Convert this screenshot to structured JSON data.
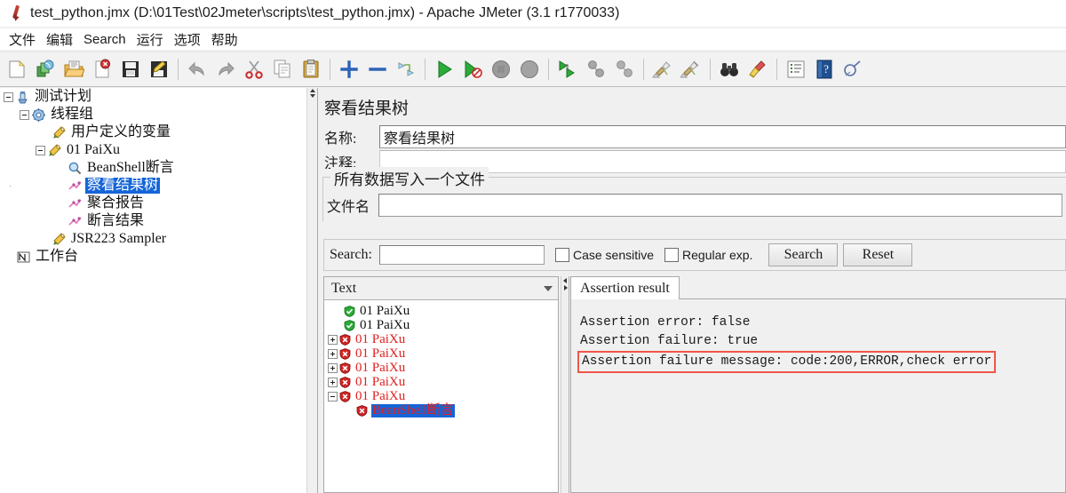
{
  "window": {
    "icon": "jmeter-feather-icon",
    "title": "test_python.jmx (D:\\01Test\\02Jmeter\\scripts\\test_python.jmx) - Apache JMeter (3.1 r1770033)"
  },
  "menubar": {
    "items": [
      {
        "label": "文件",
        "name": "menu-file"
      },
      {
        "label": "编辑",
        "name": "menu-edit"
      },
      {
        "label": "Search",
        "name": "menu-search"
      },
      {
        "label": "运行",
        "name": "menu-run"
      },
      {
        "label": "选项",
        "name": "menu-options"
      },
      {
        "label": "帮助",
        "name": "menu-help"
      }
    ]
  },
  "toolbar": {
    "buttons": [
      {
        "name": "new-icon",
        "tip": "New"
      },
      {
        "name": "templates-icon",
        "tip": "Templates"
      },
      {
        "name": "open-icon",
        "tip": "Open"
      },
      {
        "name": "close-icon",
        "tip": "Close"
      },
      {
        "name": "save-icon",
        "tip": "Save"
      },
      {
        "name": "save-as-icon",
        "tip": "Save As"
      },
      {
        "name": "undo-icon",
        "tip": "Undo"
      },
      {
        "name": "redo-icon",
        "tip": "Redo"
      },
      {
        "name": "cut-icon",
        "tip": "Cut"
      },
      {
        "name": "copy-icon",
        "tip": "Copy"
      },
      {
        "name": "paste-icon",
        "tip": "Paste"
      },
      {
        "name": "expand-all-icon",
        "tip": "Expand All"
      },
      {
        "name": "collapse-all-icon",
        "tip": "Collapse All"
      },
      {
        "name": "toggle-icon",
        "tip": "Toggle"
      },
      {
        "name": "start-icon",
        "tip": "Start"
      },
      {
        "name": "start-no-pauses-icon",
        "tip": "Start no pauses"
      },
      {
        "name": "stop-icon",
        "tip": "Stop"
      },
      {
        "name": "shutdown-icon",
        "tip": "Shutdown"
      },
      {
        "name": "remote-start-all-icon",
        "tip": "Remote Start All"
      },
      {
        "name": "remote-stop-all-icon",
        "tip": "Remote Stop All"
      },
      {
        "name": "remote-shutdown-all-icon",
        "tip": "Remote Shutdown All"
      },
      {
        "name": "clear-icon",
        "tip": "Clear"
      },
      {
        "name": "clear-all-icon",
        "tip": "Clear All"
      },
      {
        "name": "search-icon",
        "tip": "Search"
      },
      {
        "name": "search-reset-icon",
        "tip": "Reset Search"
      },
      {
        "name": "function-helper-icon",
        "tip": "Function Helper Dialog"
      },
      {
        "name": "help-icon",
        "tip": "Help"
      },
      {
        "name": "log-viewer-icon",
        "tip": "Log Viewer"
      }
    ]
  },
  "tree": {
    "nodes": [
      {
        "label": "测试计划",
        "depth": 0,
        "toggle": "minus",
        "icon": "test-plan-icon",
        "selected": false
      },
      {
        "label": "线程组",
        "depth": 1,
        "toggle": "minus",
        "icon": "thread-group-icon",
        "selected": false
      },
      {
        "label": "用户定义的变量",
        "depth": 2,
        "toggle": "none",
        "icon": "config-icon",
        "selected": false
      },
      {
        "label": "01 PaiXu",
        "depth": 2,
        "toggle": "minus",
        "icon": "sampler-icon",
        "selected": false
      },
      {
        "label": "BeanShell断言",
        "depth": 3,
        "toggle": "none",
        "icon": "assertion-icon",
        "selected": false
      },
      {
        "label": "察看结果树",
        "depth": 3,
        "toggle": "none",
        "icon": "listener-icon",
        "selected": true
      },
      {
        "label": "聚合报告",
        "depth": 3,
        "toggle": "none",
        "icon": "listener-icon",
        "selected": false
      },
      {
        "label": "断言结果",
        "depth": 3,
        "toggle": "none",
        "icon": "listener-icon",
        "selected": false
      },
      {
        "label": "JSR223 Sampler",
        "depth": 2,
        "toggle": "none",
        "icon": "sampler-icon",
        "selected": false
      },
      {
        "label": "工作台",
        "depth": 0,
        "toggle": "none",
        "icon": "workbench-icon",
        "selected": false
      }
    ]
  },
  "editor": {
    "panel_title": "察看结果树",
    "name_label": "名称:",
    "name_value": "察看结果树",
    "comment_label": "注释:",
    "comment_value": "",
    "group_title": "所有数据写入一个文件",
    "filename_label": "文件名",
    "filename_value": ""
  },
  "search": {
    "label": "Search:",
    "value": "",
    "case_sensitive_label": "Case sensitive",
    "case_sensitive_checked": false,
    "regex_label": "Regular exp.",
    "regex_checked": false,
    "search_button": "Search",
    "reset_button": "Reset"
  },
  "results": {
    "renderer_selected": "Text",
    "renderer_options": [
      "Text"
    ],
    "items": [
      {
        "label": "01 PaiXu",
        "depth": 1,
        "status": "ok",
        "toggle": "none",
        "selected": false
      },
      {
        "label": "01 PaiXu",
        "depth": 1,
        "status": "ok",
        "toggle": "none",
        "selected": false
      },
      {
        "label": "01 PaiXu",
        "depth": 1,
        "status": "error",
        "toggle": "plus",
        "selected": false
      },
      {
        "label": "01 PaiXu",
        "depth": 1,
        "status": "error",
        "toggle": "plus",
        "selected": false
      },
      {
        "label": "01 PaiXu",
        "depth": 1,
        "status": "error",
        "toggle": "plus",
        "selected": false
      },
      {
        "label": "01 PaiXu",
        "depth": 1,
        "status": "error",
        "toggle": "plus",
        "selected": false
      },
      {
        "label": "01 PaiXu",
        "depth": 1,
        "status": "error",
        "toggle": "minus",
        "selected": false
      },
      {
        "label": "BeanShell断言",
        "depth": 2,
        "status": "error",
        "toggle": "none",
        "selected": true
      }
    ]
  },
  "assertion": {
    "tab_label": "Assertion result",
    "lines": [
      {
        "text": "Assertion error: false",
        "boxed": false
      },
      {
        "text": "Assertion failure: true",
        "boxed": false
      },
      {
        "text": "Assertion failure message: code:200,ERROR,check error",
        "boxed": true
      }
    ]
  },
  "colors": {
    "highlight": "#1565d8",
    "error_text": "#e02020",
    "error_box": "#f0564a",
    "panel_bg": "#f0f0f0",
    "success_green": "#2aab3a"
  }
}
